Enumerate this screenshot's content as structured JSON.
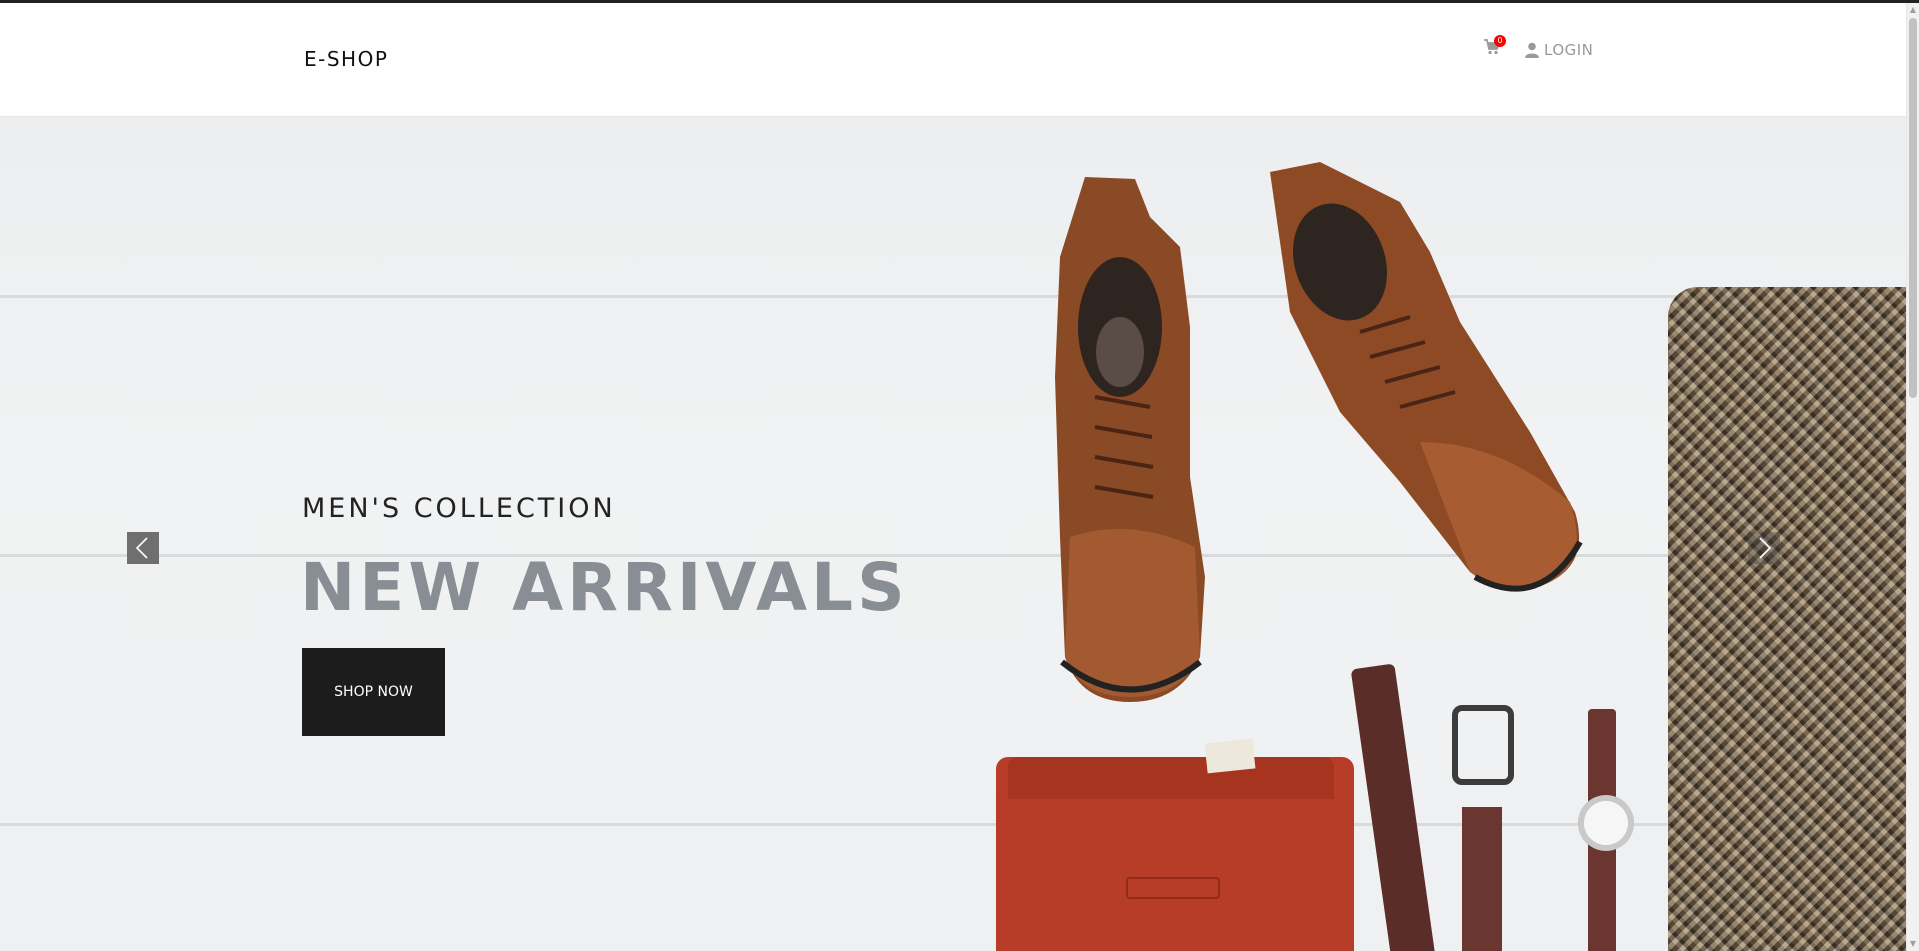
{
  "header": {
    "brand": "E-SHOP",
    "cart_count": "0",
    "login_label": "LOGIN"
  },
  "hero": {
    "subtitle": "MEN'S COLLECTION",
    "title": "NEW ARRIVALS",
    "cta_label": "SHOP NOW"
  },
  "icons": {
    "cart": "cart-icon",
    "user": "user-icon",
    "prev": "chevron-left-icon",
    "next": "chevron-right-icon"
  },
  "colors": {
    "cta_background": "#1c1c1c",
    "badge": "#ff0000",
    "title_gray": "#888e94"
  }
}
